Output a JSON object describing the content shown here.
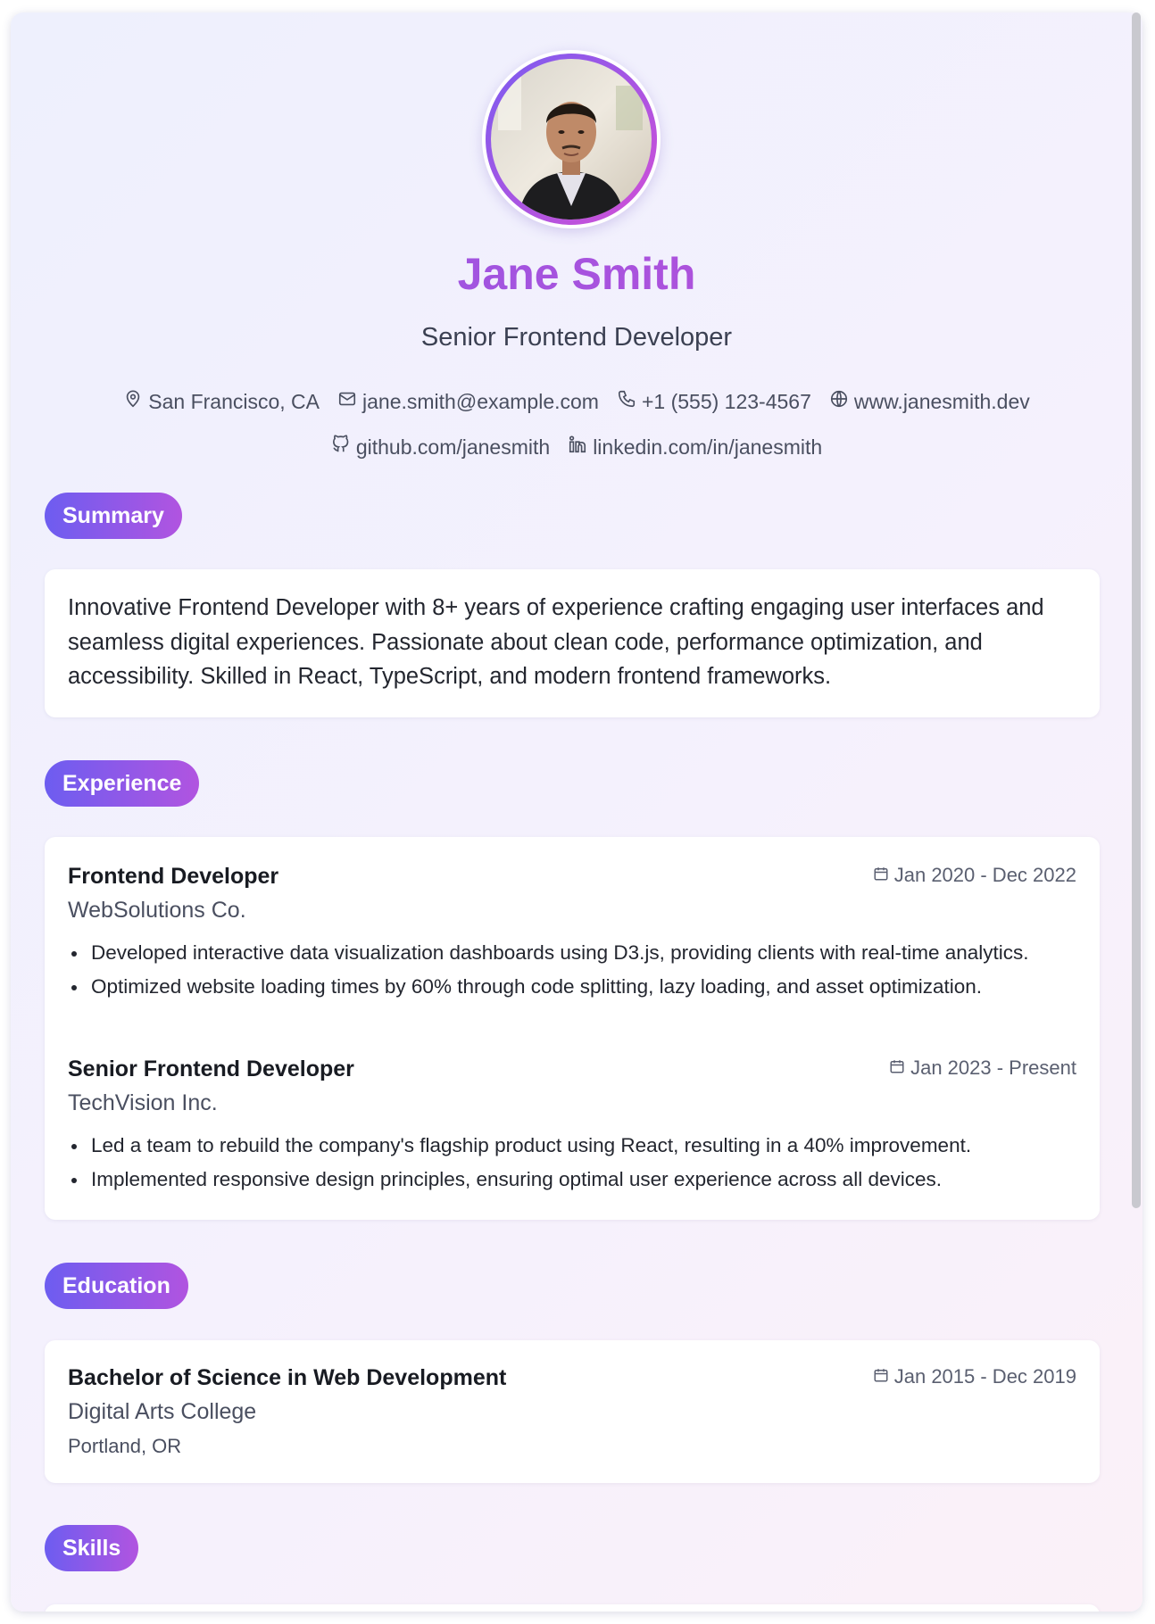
{
  "profile": {
    "name": "Jane Smith",
    "title": "Senior Frontend Developer",
    "photo_icon": "profile-photo"
  },
  "contact": {
    "location": "San Francisco, CA",
    "email": "jane.smith@example.com",
    "phone": "+1 (555) 123-4567",
    "website": "www.janesmith.dev",
    "github": "github.com/janesmith",
    "linkedin": "linkedin.com/in/janesmith"
  },
  "sections": {
    "summary": "Summary",
    "experience": "Experience",
    "education": "Education",
    "skills": "Skills"
  },
  "summary": {
    "text": "Innovative Frontend Developer with 8+ years of experience crafting engaging user interfaces and seamless digital experiences. Passionate about clean code, performance optimization, and accessibility. Skilled in React, TypeScript, and modern frontend frameworks."
  },
  "experience": [
    {
      "role": "Frontend Developer",
      "company": "WebSolutions Co.",
      "dates": "Jan 2020 - Dec 2022",
      "bullets": [
        "Developed interactive data visualization dashboards using D3.js, providing clients with real-time analytics.",
        "Optimized website loading times by 60% through code splitting, lazy loading, and asset optimization."
      ]
    },
    {
      "role": "Senior Frontend Developer",
      "company": "TechVision Inc.",
      "dates": "Jan 2023 - Present",
      "bullets": [
        "Led a team to rebuild the company's flagship product using React, resulting in a 40% improvement.",
        "Implemented responsive design principles, ensuring optimal user experience across all devices."
      ]
    }
  ],
  "education": [
    {
      "degree": "Bachelor of Science in Web Development",
      "school": "Digital Arts College",
      "location": "Portland, OR",
      "dates": "Jan 2015 - Dec 2019"
    }
  ],
  "colors": {
    "accent_start": "#6d5df0",
    "accent_end": "#b154e0",
    "name_color": "#a24fd8"
  }
}
